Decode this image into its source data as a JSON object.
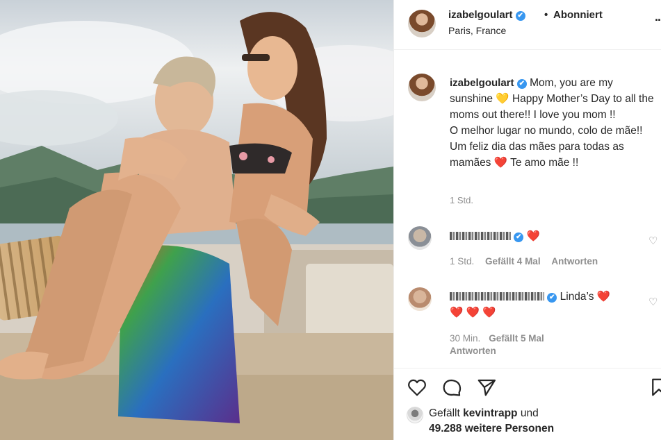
{
  "header": {
    "username": "izabelgoulart",
    "verified_mark": "✔",
    "separator": "•",
    "follow_status": "Abonniert",
    "location": "Paris, France",
    "more_icon": "..."
  },
  "caption": {
    "username": "izabelgoulart",
    "text_part1": "Mom, you are my sunshine ",
    "sun_heart": "💛",
    "text_part2": "  Happy Mother’s Day to all the moms out there!! I love you mom !!",
    "text_part3": "O melhor lugar no mundo, colo de mãe!! Um feliz dia das mães para todas as mamães ",
    "red_heart": "❤️",
    "text_part4": "  Te amo mãe !!",
    "time": "1 Std."
  },
  "comments": [
    {
      "text": "❤️",
      "time": "1 Std.",
      "likes": "Gefällt 4 Mal",
      "reply": "Antworten"
    },
    {
      "text": "Linda’s ❤️",
      "line2": "❤️ ❤️ ❤️",
      "time": "30 Min.",
      "likes": "Gefällt 5 Mal",
      "reply": "Antworten"
    }
  ],
  "actions": {
    "icons": [
      "heart-outline-icon",
      "comment-bubble-icon",
      "paper-plane-icon",
      "bookmark-icon"
    ],
    "liked_by_prefix": "Gefällt",
    "liked_by_user": "kevintrapp",
    "liked_by_suffix": "und",
    "others": "49.288 weitere Personen"
  },
  "colors": {
    "verified": "#3897f0",
    "text": "#262626",
    "muted": "#8e8e8e",
    "heart": "#e0245e"
  }
}
